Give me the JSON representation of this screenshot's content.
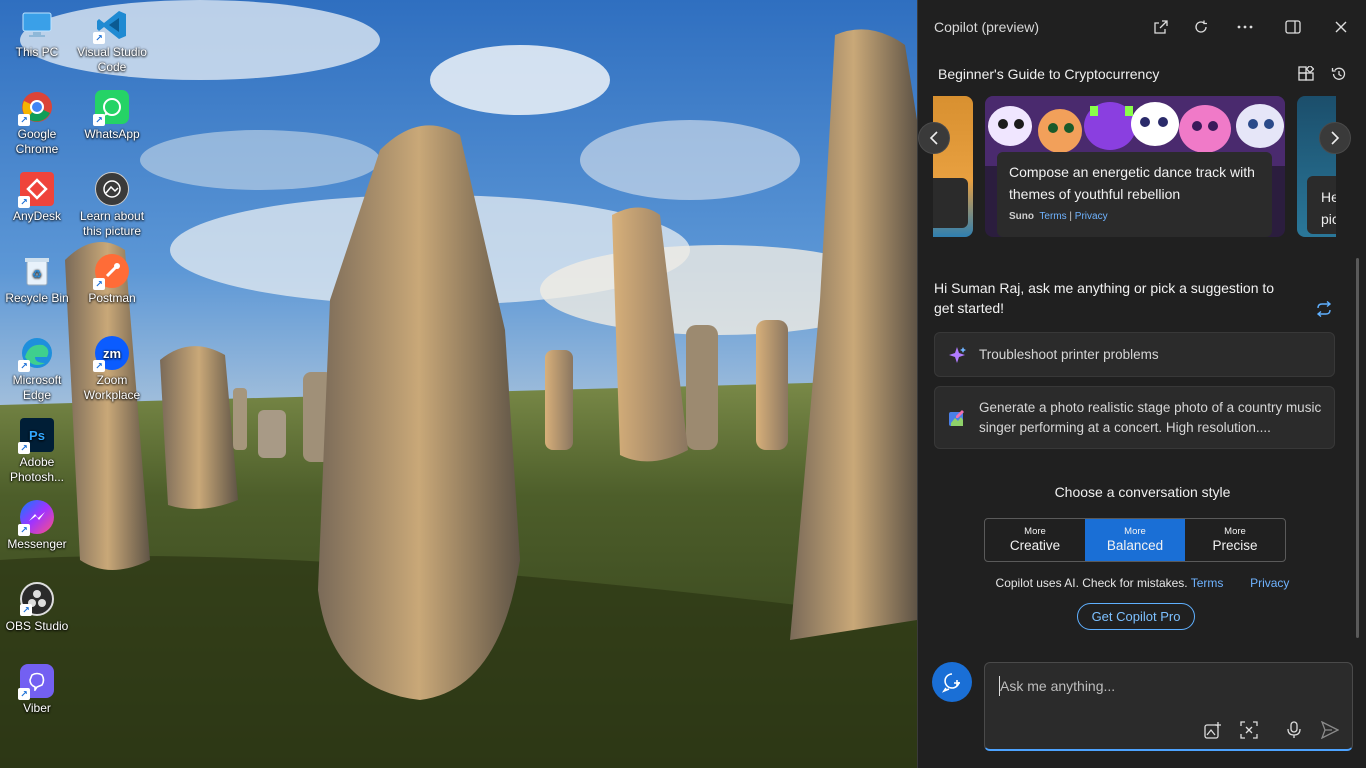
{
  "desktop": {
    "icons": [
      {
        "label": "This PC",
        "icon": "this-pc-icon"
      },
      {
        "label": "Visual Studio Code",
        "icon": "vscode-icon"
      },
      {
        "label": "Google Chrome",
        "icon": "chrome-icon"
      },
      {
        "label": "WhatsApp",
        "icon": "whatsapp-icon"
      },
      {
        "label": "AnyDesk",
        "icon": "anydesk-icon"
      },
      {
        "label": "Learn about this picture",
        "icon": "learn-picture-icon"
      },
      {
        "label": "Recycle Bin",
        "icon": "recycle-bin-icon"
      },
      {
        "label": "Postman",
        "icon": "postman-icon"
      },
      {
        "label": "Microsoft Edge",
        "icon": "edge-icon"
      },
      {
        "label": "Zoom Workplace",
        "icon": "zoom-icon"
      },
      {
        "label": "Adobe Photosh...",
        "icon": "photoshop-icon"
      },
      {
        "label": "Messenger",
        "icon": "messenger-icon"
      },
      {
        "label": "OBS Studio",
        "icon": "obs-icon"
      },
      {
        "label": "Viber",
        "icon": "viber-icon"
      }
    ]
  },
  "copilot": {
    "title": "Copilot (preview)",
    "titlebar_icons": [
      "open-external-icon",
      "refresh-icon",
      "more-icon",
      "sidebar-toggle-icon",
      "close-icon"
    ],
    "header": "Beginner's Guide to Cryptocurrency",
    "header_icons": [
      "plugins-icon",
      "history-icon"
    ],
    "carousel": {
      "card_text": "Compose an energetic dance track with themes of youthful rebellion",
      "card_source": "Suno",
      "card_terms": "Terms",
      "card_separator": "|",
      "card_privacy": "Privacy",
      "next_card_text": "He\npic"
    },
    "greeting": "Hi Suman Raj, ask me anything or pick a suggestion to get started!",
    "suggestions": [
      {
        "text": "Troubleshoot printer problems",
        "icon": "sparkle-icon"
      },
      {
        "text": "Generate a photo realistic stage photo of a country music singer performing at a concert. High resolution....",
        "icon": "image-create-icon"
      }
    ],
    "style_title": "Choose a conversation style",
    "styles": [
      {
        "small": "More",
        "large": "Creative"
      },
      {
        "small": "More",
        "large": "Balanced"
      },
      {
        "small": "More",
        "large": "Precise"
      }
    ],
    "active_style": "Balanced",
    "disclaimer": "Copilot uses AI. Check for mistakes.",
    "disclaimer_terms": "Terms",
    "disclaimer_privacy": "Privacy",
    "pro_button": "Get Copilot Pro",
    "input_placeholder": "Ask me anything...",
    "input_icons": [
      "add-image-icon",
      "screenshot-icon",
      "microphone-icon",
      "send-icon"
    ],
    "accent_color": "#1a6fd6"
  }
}
